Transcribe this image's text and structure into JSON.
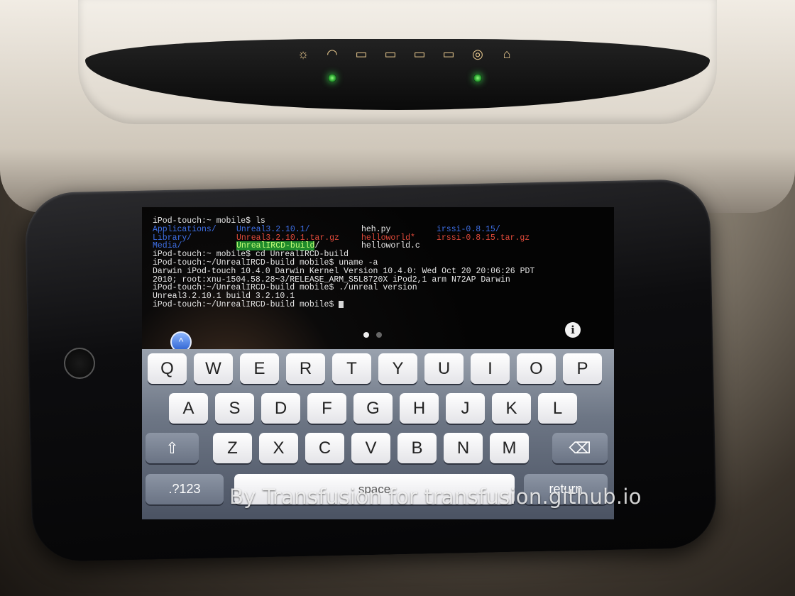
{
  "terminal": {
    "lines": [
      {
        "prompt": "iPod-touch:~ mobile$ ",
        "cmd": "ls"
      },
      {
        "col1": "Applications/",
        "col2": "Unreal3.2.10.1/",
        "col3": "heh.py",
        "col4": "irssi-0.8.15/"
      },
      {
        "col1": "Library/",
        "col2": "Unreal3.2.10.1.tar.gz",
        "col3": "helloworld*",
        "col4": "irssi-0.8.15.tar.gz"
      },
      {
        "col1": "Media/",
        "col2": "UnrealIRCD-build",
        "col2_suffix": "/",
        "col3": "helloworld.c"
      },
      {
        "prompt": "iPod-touch:~ mobile$ ",
        "cmd": "cd UnrealIRCD-build"
      },
      {
        "prompt": "iPod-touch:~/UnrealIRCD-build mobile$ ",
        "cmd": "uname -a"
      },
      {
        "text": "Darwin iPod-touch 10.4.0 Darwin Kernel Version 10.4.0: Wed Oct 20 20:06:26 PDT"
      },
      {
        "text": "2010; root:xnu-1504.58.28~3/RELEASE_ARM_S5L8720X iPod2,1 arm N72AP Darwin"
      },
      {
        "prompt": "iPod-touch:~/UnrealIRCD-build mobile$ ",
        "cmd": "./unreal version"
      },
      {
        "text": "Unreal3.2.10.1 build 3.2.10.1"
      },
      {
        "prompt": "iPod-touch:~/UnrealIRCD-build mobile$ ",
        "cmd": ""
      }
    ]
  },
  "colors": {
    "dir": "#3e6fe6",
    "archive": "#e04a3a",
    "executable": "#e04a3a",
    "highlight_bg": "#1f8a2b",
    "highlight_fg": "#c6ff7a"
  },
  "icons": {
    "info": "i",
    "scroll_up": "^",
    "backspace": "⌫",
    "shift": "⇧"
  },
  "keyboard": {
    "row1": [
      "Q",
      "W",
      "E",
      "R",
      "T",
      "Y",
      "U",
      "I",
      "O",
      "P"
    ],
    "row2": [
      "A",
      "S",
      "D",
      "F",
      "G",
      "H",
      "J",
      "K",
      "L"
    ],
    "row3": [
      "Z",
      "X",
      "C",
      "V",
      "B",
      "N",
      "M"
    ],
    "numbers_label": ".?123",
    "space_label": "space",
    "return_label": "return"
  },
  "watermark": "By Transfusion for transfusion.github.io"
}
